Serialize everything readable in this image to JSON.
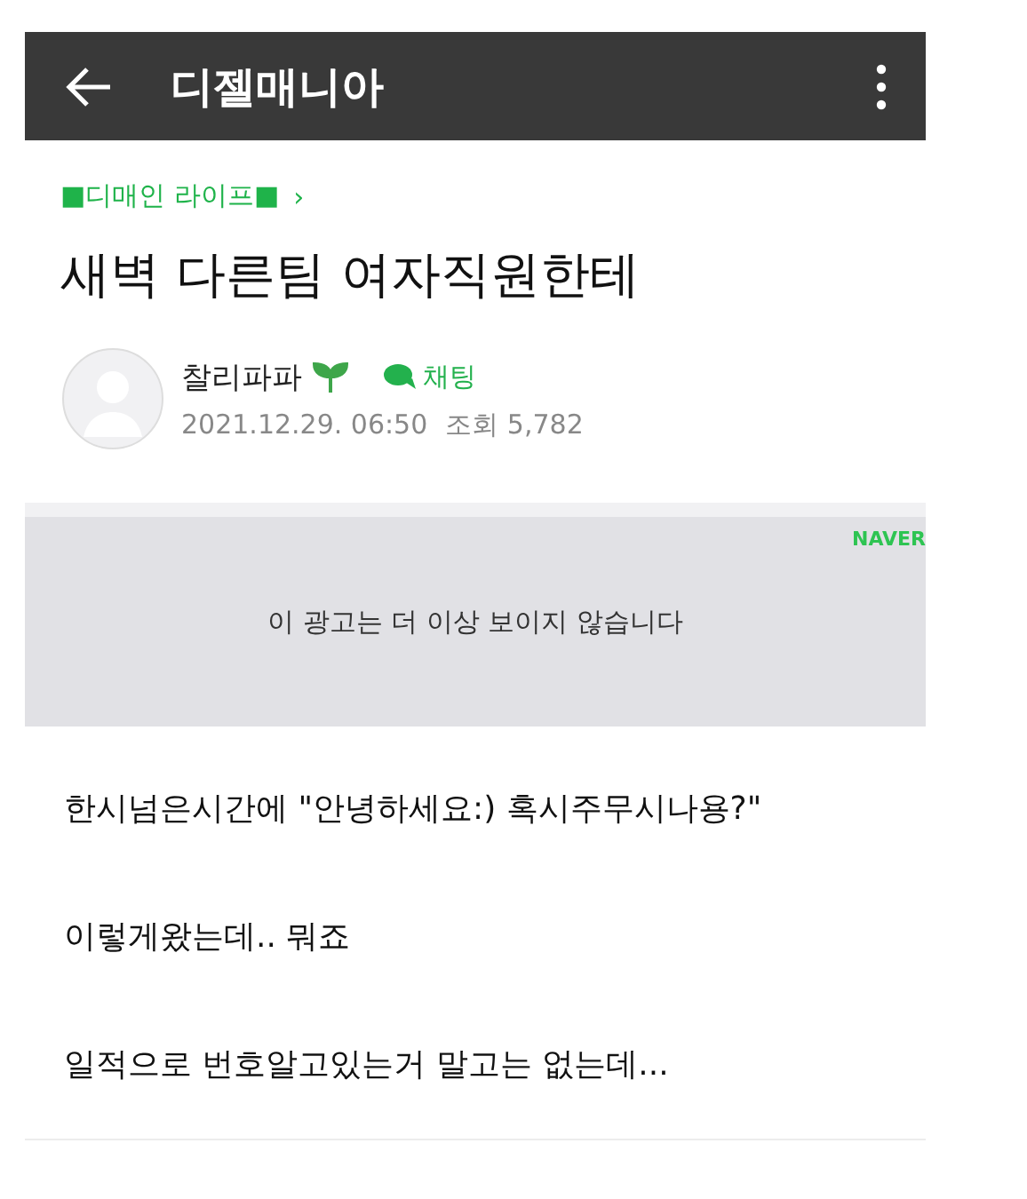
{
  "app_bar": {
    "title": "디젤매니아"
  },
  "category": {
    "label": "■디매인 라이프■",
    "arrow": "›"
  },
  "post": {
    "title": "새벽 다른팀 여자직원한테",
    "author": "찰리파파",
    "chat": "채팅",
    "date": "2021.12.29. 06:50",
    "views": "조회 5,782"
  },
  "ad": {
    "brand": "NAVER",
    "message": "이 광고는 더 이상 보이지 않습니다"
  },
  "paragraphs": [
    "한시넘은시간에 \"안녕하세요:) 혹시주무시나용?\"",
    "이렇게왔는데.. 뭐죠",
    "일적으로 번호알고있는거 말고는 없는데..."
  ]
}
